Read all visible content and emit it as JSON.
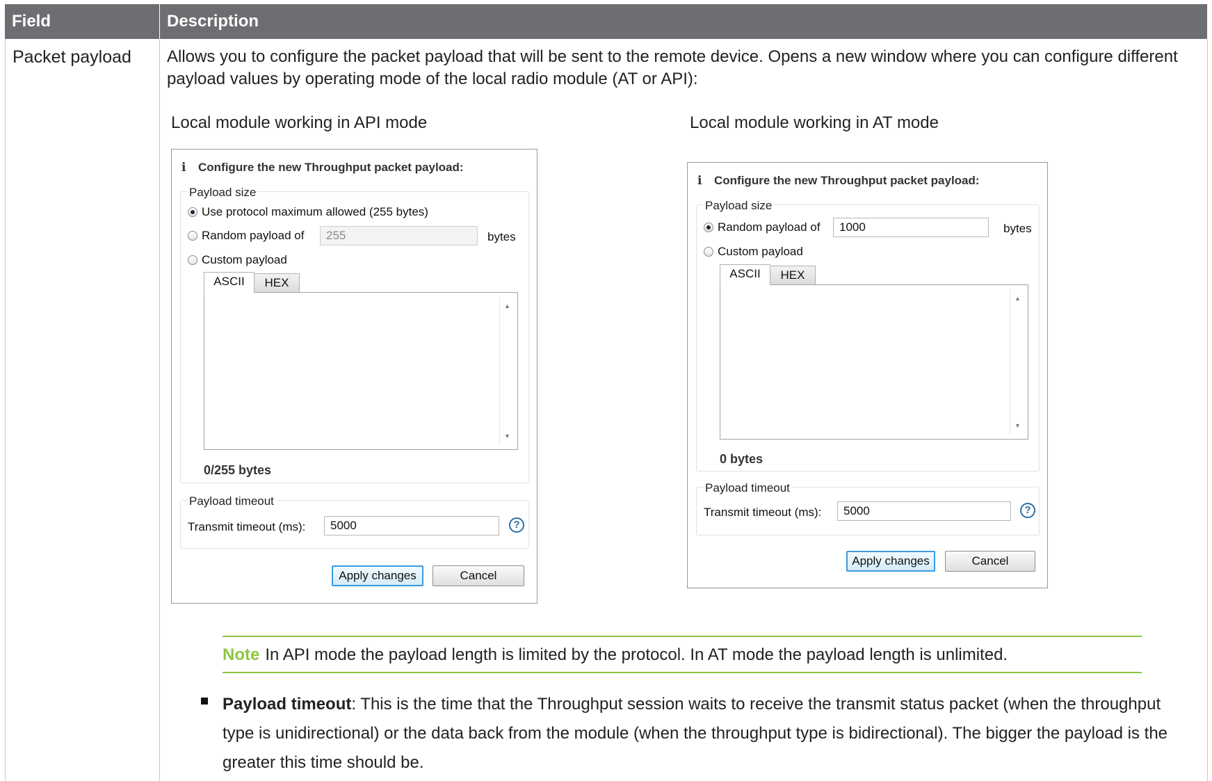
{
  "table": {
    "header_field": "Field",
    "header_description": "Description",
    "field_name": "Packet payload",
    "intro": "Allows you to configure the packet payload that will be sent to the remote device. Opens a new window where you can configure different payload values by operating mode of the local radio module (AT or API):"
  },
  "api_dialog": {
    "caption": "Local module working in API mode",
    "info": "Configure the new Throughput packet payload:",
    "payload_size_group": "Payload size",
    "option_max": "Use protocol maximum allowed (255 bytes)",
    "option_random": "Random payload of",
    "random_value": "255",
    "bytes_unit": "bytes",
    "option_custom": "Custom payload",
    "tab_ascii": "ASCII",
    "tab_hex": "HEX",
    "byte_count": "0/255 bytes",
    "timeout_group": "Payload timeout",
    "timeout_label": "Transmit timeout (ms):",
    "timeout_value": "5000",
    "help": "?",
    "apply": "Apply changes",
    "cancel": "Cancel"
  },
  "at_dialog": {
    "caption": "Local module working in AT mode",
    "info": "Configure the new Throughput packet payload:",
    "payload_size_group": "Payload size",
    "option_random": "Random payload of",
    "random_value": "1000",
    "bytes_unit": "bytes",
    "option_custom": "Custom payload",
    "tab_ascii": "ASCII",
    "tab_hex": "HEX",
    "byte_count": "0 bytes",
    "timeout_group": "Payload timeout",
    "timeout_label": "Transmit timeout (ms):",
    "timeout_value": "5000",
    "help": "?",
    "apply": "Apply changes",
    "cancel": "Cancel"
  },
  "note": {
    "label": "Note",
    "text": "In API mode the payload length is limited by the protocol. In AT mode the payload length is unlimited."
  },
  "bullet": {
    "term": "Payload timeout",
    "text": ": This is the time that the Throughput session waits to receive the transmit status packet (when the throughput type is unidirectional) or the data back from the module (when the throughput type is bidirectional). The bigger the payload is the greater this time should be."
  },
  "colors": {
    "header_bg": "#6d6e71",
    "note_accent": "#8cc63f",
    "primary_button_border": "#3a9be0"
  }
}
